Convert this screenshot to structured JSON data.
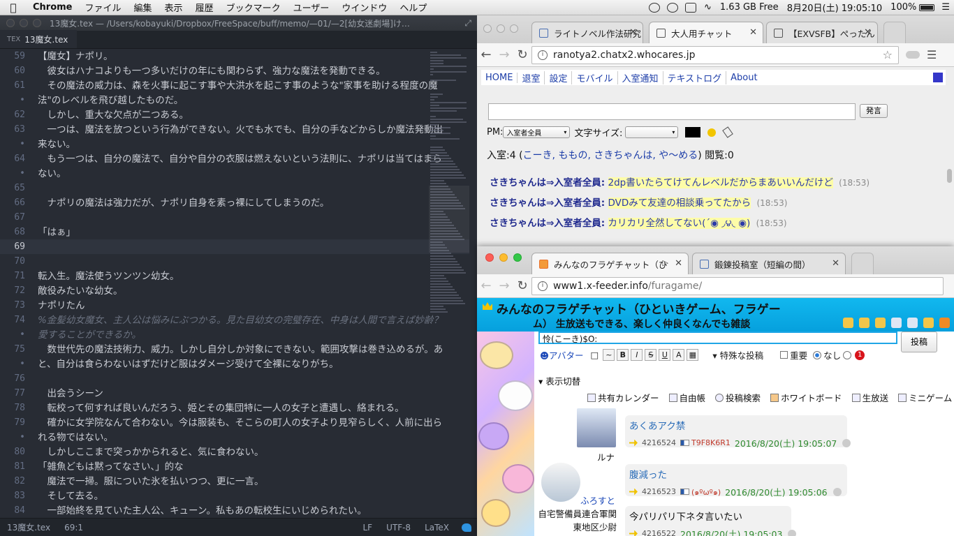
{
  "menubar": {
    "app": "Chrome",
    "items": [
      "ファイル",
      "編集",
      "表示",
      "履歴",
      "ブックマーク",
      "ユーザー",
      "ウインドウ",
      "ヘルプ"
    ],
    "memory": "1.63 GB Free",
    "clock": "8月20日(土)  19:05:10",
    "battery": "100%"
  },
  "editor": {
    "title": "13魔女.tex — /Users/kobayuki/Dropbox/FreeSpace/buff/memo/—01/—2[幼女迷劇場]け…",
    "tab": "13魔女.tex",
    "tab_icon": "TEX",
    "lines": [
      {
        "n": "59",
        "text": "【魔女】ナポリ。"
      },
      {
        "n": "60",
        "text": "　彼女はハナコよりも一つ多いだけの年にも関わらず、強力な魔法を発動できる。"
      },
      {
        "n": "61",
        "text": "　その魔法の威力は、森を火事に起こす事や大洪水を起こす事のような\"家事を助ける程度の魔"
      },
      {
        "n": "•",
        "text": "法\"のレベルを飛び越したものだ。"
      },
      {
        "n": "62",
        "text": "　しかし、重大な欠点が二つある。"
      },
      {
        "n": "63",
        "text": "　一つは、魔法を放つという行為ができない。火でも水でも、自分の手などからしか魔法発動出"
      },
      {
        "n": "•",
        "text": "来ない。"
      },
      {
        "n": "64",
        "text": "　もう一つは、自分の魔法で、自分や自分の衣服は燃えないという法則に、ナポリは当てはまら"
      },
      {
        "n": "•",
        "text": "ない。"
      },
      {
        "n": "65",
        "text": ""
      },
      {
        "n": "66",
        "text": "　ナポリの魔法は強力だが、ナポリ自身を素っ裸にしてしまうのだ。"
      },
      {
        "n": "67",
        "text": ""
      },
      {
        "n": "68",
        "text": "「はぁ」"
      },
      {
        "n": "69",
        "text": ""
      },
      {
        "n": "70",
        "text": ""
      },
      {
        "n": "71",
        "text": "転入生。魔法使うツンツン幼女。"
      },
      {
        "n": "72",
        "text": "敵役みたいな幼女。"
      },
      {
        "n": "73",
        "text": "ナポリたん"
      },
      {
        "n": "74",
        "text": "%金髪幼女魔女、主人公は悩みにぶつかる。見た目幼女の完璧存在、中身は人間で言えば妙齢？"
      },
      {
        "n": "•",
        "text": "愛することができるか。"
      },
      {
        "n": "75",
        "text": "　数世代先の魔法技術力、威力。しかし自分しか対象にできない。範囲攻撃は巻き込めるが。あ"
      },
      {
        "n": "•",
        "text": "と、自分は食らわないはずだけど服はダメージ受けて全裸になりがち。"
      },
      {
        "n": "76",
        "text": ""
      },
      {
        "n": "77",
        "text": "　出会うシーン"
      },
      {
        "n": "78",
        "text": "　転校って何すれば良いんだろう、姫とその集団特に一人の女子と遭遇し、絡まれる。"
      },
      {
        "n": "79",
        "text": "　確かに女学院なんて合わない。今は服装も、そこらの町人の女子より見窄らしく、人前に出ら"
      },
      {
        "n": "•",
        "text": "れる物ではない。"
      },
      {
        "n": "80",
        "text": "　しかしここまで突っかかられると、気に食わない。"
      },
      {
        "n": "81",
        "text": "「雑魚どもは黙ってなさい、」的な"
      },
      {
        "n": "82",
        "text": "　魔法で一掃。服についた氷を払いつつ、更に一言。"
      },
      {
        "n": "83",
        "text": "　そして去る。"
      },
      {
        "n": "84",
        "text": "　一部始終を見ていた主人公、キューン。私もあの転校生にいじめられたい。"
      }
    ],
    "status": {
      "file": "13魔女.tex",
      "cursor": "69:1",
      "eol": "LF",
      "encoding": "UTF-8",
      "grammar": "LaTeX"
    }
  },
  "browser1": {
    "tabs": [
      "ライトノベル作法研究",
      "大人用チャット",
      "【EXVSFB】ぺったん"
    ],
    "url": "ranotya2.chatx2.whocares.jp",
    "nav_links": [
      "HOME",
      "退室",
      "設定",
      "モバイル",
      "入室通知",
      "テキストログ",
      "About"
    ],
    "send_label": "発言",
    "pm_label": "PM:",
    "pm_value": "入室者全員",
    "fontsize_label": "文字サイズ:",
    "room_prefix": "入室:4  (",
    "room_users": "こーき, ももの, さきちゃんは, や～める",
    "room_suffix": ")  閲覧:0",
    "messages": [
      {
        "who": "さきちゃんは⇒入室者全員:",
        "text": "2dp書いたらてけてんレベルだからまあいいんだけど",
        "time": "(18:53)"
      },
      {
        "who": "さきちゃんは⇒入室者全員:",
        "text": "DVDみて友達の相談乗ってたから",
        "time": "(18:53)"
      },
      {
        "who": "さきちゃんは⇒入室者全員:",
        "text": "カリカリ全然してない(´◉ ◞౪◟ ◉)",
        "time": "(18:53)"
      }
    ],
    "colors": {
      "link": "#1c3da8",
      "highlight": "#fdfca8"
    }
  },
  "browser2": {
    "tabs": [
      "みんなのフラゲチャット（ひ",
      "鍛錬投稿室（短編の間）"
    ],
    "url_host": "www1.x-feeder.info",
    "url_path": "/furagame/",
    "header_title": "みんなのフラゲチャット（ひといきゲーム、フラゲー",
    "header_sub": "ム）  生放送もできる、楽しく仲良くなんでも雑談",
    "post_input": "怜(こーき)$O:",
    "post_button": "投稿",
    "avatar_link": "アバター",
    "special_post": "特殊な投稿",
    "important": "重要",
    "none": "なし",
    "badge": "1",
    "toggle_label": "表示切替",
    "links": [
      "共有カレンダー",
      "自由帳",
      "投稿検索",
      "ホワイトボード",
      "生放送",
      "ミニゲーム"
    ],
    "posts": [
      {
        "user": "ルナ",
        "text": "あくあアク禁",
        "num": "4216524",
        "trip": "T9F8K6R1",
        "time": "2016/8/20(土) 19:05:07"
      },
      {
        "user": "ふろすと",
        "text": "腹減った",
        "num": "4216523",
        "trip": "(๑ºωº๑)",
        "time": "2016/8/20(土) 19:05:06"
      },
      {
        "user": "自宅警備員連合軍関東地区少尉",
        "text": "今パリパリ下ネタ言いたい",
        "num": "4216522",
        "trip": "",
        "time": "2016/8/20(土) 19:05:03"
      }
    ],
    "colors": {
      "header": "#11b8ef",
      "timestamp": "#2f8a2f",
      "postlink": "#2a6cb8"
    }
  }
}
